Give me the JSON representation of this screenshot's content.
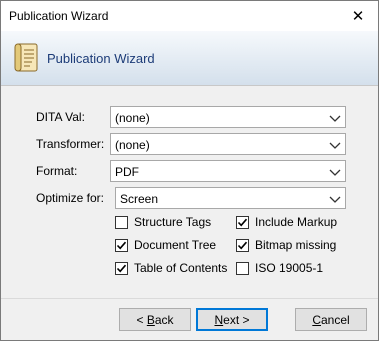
{
  "window": {
    "title": "Publication Wizard",
    "close_glyph": "✕"
  },
  "banner": {
    "title": "Publication Wizard",
    "icon": "document-scroll-icon"
  },
  "form": {
    "dita_val": {
      "label": "DITA Val:",
      "value": "(none)"
    },
    "transformer": {
      "label": "Transformer:",
      "value": "(none)"
    },
    "format": {
      "label": "Format:",
      "value": "PDF"
    },
    "optimize_for": {
      "label": "Optimize for:",
      "value": "Screen"
    }
  },
  "options": {
    "structure_tags": {
      "label": "Structure Tags",
      "checked": false
    },
    "include_markup": {
      "label": "Include Markup",
      "checked": true
    },
    "document_tree": {
      "label": "Document Tree",
      "checked": true
    },
    "bitmap_missing": {
      "label": "Bitmap missing",
      "checked": true
    },
    "table_of_contents": {
      "label": "Table of Contents",
      "checked": true
    },
    "iso_19005_1": {
      "label": "ISO 19005-1",
      "checked": false
    }
  },
  "buttons": {
    "back": {
      "prefix": "< ",
      "mnemonic": "B",
      "rest": "ack"
    },
    "next": {
      "mnemonic": "N",
      "rest": "ext >"
    },
    "cancel": {
      "mnemonic": "C",
      "rest": "ancel"
    }
  }
}
